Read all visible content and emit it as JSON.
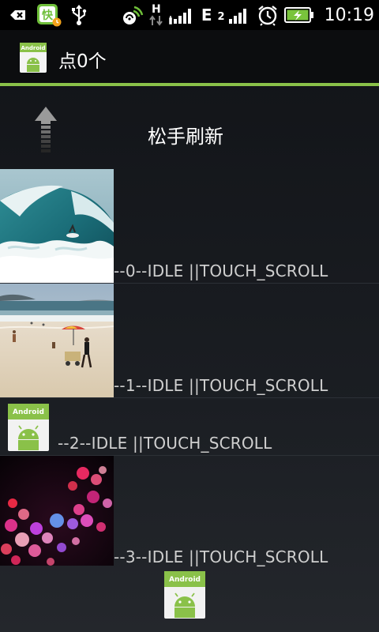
{
  "statusbar": {
    "network_letter": "E",
    "sim_two": "2",
    "time": "10:19",
    "icons": [
      "back-notification-icon",
      "kuaibo-app-icon",
      "usb-icon",
      "wifi-hotspot-icon",
      "data-transfer-icon",
      "signal-icon",
      "signal-2-icon",
      "alarm-icon",
      "battery-charging-icon"
    ],
    "data_h": "H"
  },
  "titlebar": {
    "title": "点0个",
    "icon": "android-app-icon",
    "accent_color": "#8ac149"
  },
  "refresh": {
    "text": "松手刷新",
    "icon": "up-arrow-icon"
  },
  "list": {
    "items": [
      {
        "label": "--0--IDLE ||TOUCH_SCROLL",
        "image": "ocean-wave-photo"
      },
      {
        "label": "--1--IDLE ||TOUCH_SCROLL",
        "image": "beach-photo"
      },
      {
        "label": "--2--IDLE ||TOUCH_SCROLL",
        "image": "android-default-icon"
      },
      {
        "label": "--3--IDLE ||TOUCH_SCROLL",
        "image": "bokeh-lights-photo"
      }
    ]
  },
  "footer": {
    "icon": "android-loading-icon",
    "android_text": "Android"
  }
}
